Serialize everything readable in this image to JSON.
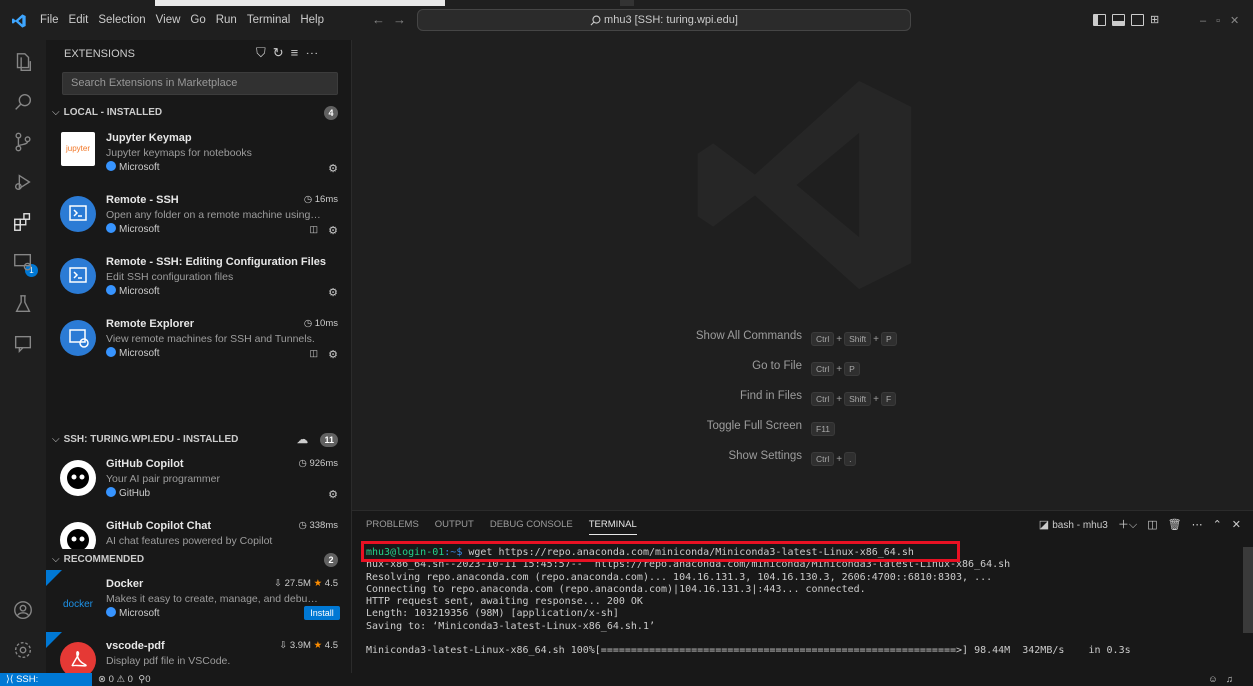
{
  "menu": [
    "File",
    "Edit",
    "Selection",
    "View",
    "Go",
    "Run",
    "Terminal",
    "Help"
  ],
  "command_center": "mhu3 [SSH: turing.wpi.edu]",
  "sidebar": {
    "title": "EXTENSIONS",
    "search_placeholder": "Search Extensions in Marketplace",
    "local_section": {
      "label": "LOCAL - INSTALLED",
      "count": "4"
    },
    "ssh_section": {
      "label": "SSH: TURING.WPI.EDU - INSTALLED",
      "count": "11"
    },
    "recommended_section": {
      "label": "RECOMMENDED",
      "count": "2"
    }
  },
  "extensions_local": [
    {
      "name": "Jupyter Keymap",
      "desc": "Jupyter keymaps for notebooks",
      "publisher": "Microsoft",
      "stat": "",
      "icon_label": "jupyter"
    },
    {
      "name": "Remote - SSH",
      "desc": "Open any folder on a remote machine using S...",
      "publisher": "Microsoft",
      "stat": "16ms"
    },
    {
      "name": "Remote - SSH: Editing Configuration Files",
      "desc": "Edit SSH configuration files",
      "publisher": "Microsoft",
      "stat": ""
    },
    {
      "name": "Remote Explorer",
      "desc": "View remote machines for SSH and Tunnels.",
      "publisher": "Microsoft",
      "stat": "10ms"
    }
  ],
  "extensions_ssh": [
    {
      "name": "GitHub Copilot",
      "desc": "Your AI pair programmer",
      "publisher": "GitHub",
      "stat": "926ms"
    },
    {
      "name": "GitHub Copilot Chat",
      "desc": "AI chat features powered by Copilot",
      "publisher": "",
      "stat": "338ms"
    }
  ],
  "extensions_recommended": [
    {
      "name": "Docker",
      "desc": "Makes it easy to create, manage, and debug c...",
      "publisher": "Microsoft",
      "downloads": "27.5M",
      "rating": "4.5",
      "action": "Install",
      "icon_label": "docker"
    },
    {
      "name": "vscode-pdf",
      "desc": "Display pdf file in VSCode.",
      "publisher": "",
      "downloads": "3.9M",
      "rating": "4.5"
    }
  ],
  "shortcuts": [
    {
      "label": "Show All Commands",
      "keys": [
        "Ctrl",
        "Shift",
        "P"
      ]
    },
    {
      "label": "Go to File",
      "keys": [
        "Ctrl",
        "P"
      ]
    },
    {
      "label": "Find in Files",
      "keys": [
        "Ctrl",
        "Shift",
        "F"
      ]
    },
    {
      "label": "Toggle Full Screen",
      "keys": [
        "F11"
      ]
    },
    {
      "label": "Show Settings",
      "keys": [
        "Ctrl",
        "."
      ]
    }
  ],
  "panel": {
    "tabs": [
      "PROBLEMS",
      "OUTPUT",
      "DEBUG CONSOLE",
      "TERMINAL"
    ],
    "active_tab": "TERMINAL",
    "terminal_name": "bash - mhu3"
  },
  "terminal": {
    "prompt_user": "mhu3@login-01",
    "prompt_path": ":~$ ",
    "command": "wget https://repo.anaconda.com/miniconda/Miniconda3-latest-Linux-x86_64.sh",
    "lines": [
      "nux-x86_64.sh--2023-10-11 15:45:57--  https://repo.anaconda.com/miniconda/Miniconda3-latest-Linux-x86_64.sh",
      "Resolving repo.anaconda.com (repo.anaconda.com)... 104.16.131.3, 104.16.130.3, 2606:4700::6810:8303, ...",
      "Connecting to repo.anaconda.com (repo.anaconda.com)|104.16.131.3|:443... connected.",
      "HTTP request sent, awaiting response... 200 OK",
      "Length: 103219356 (98M) [application/x-sh]",
      "Saving to: ‘Miniconda3-latest-Linux-x86_64.sh.1’",
      "",
      "Miniconda3-latest-Linux-x86_64.sh 100%[===========================================================>] 98.44M  342MB/s    in 0.3s"
    ]
  },
  "statusbar": {
    "remote": "SSH: turing.wpi.edu",
    "problems": "⊗ 0 ⚠ 0",
    "ports": "0"
  },
  "colors": {
    "accent": "#0078d4",
    "highlight": "#e81123",
    "prompt": "#23d18b"
  }
}
